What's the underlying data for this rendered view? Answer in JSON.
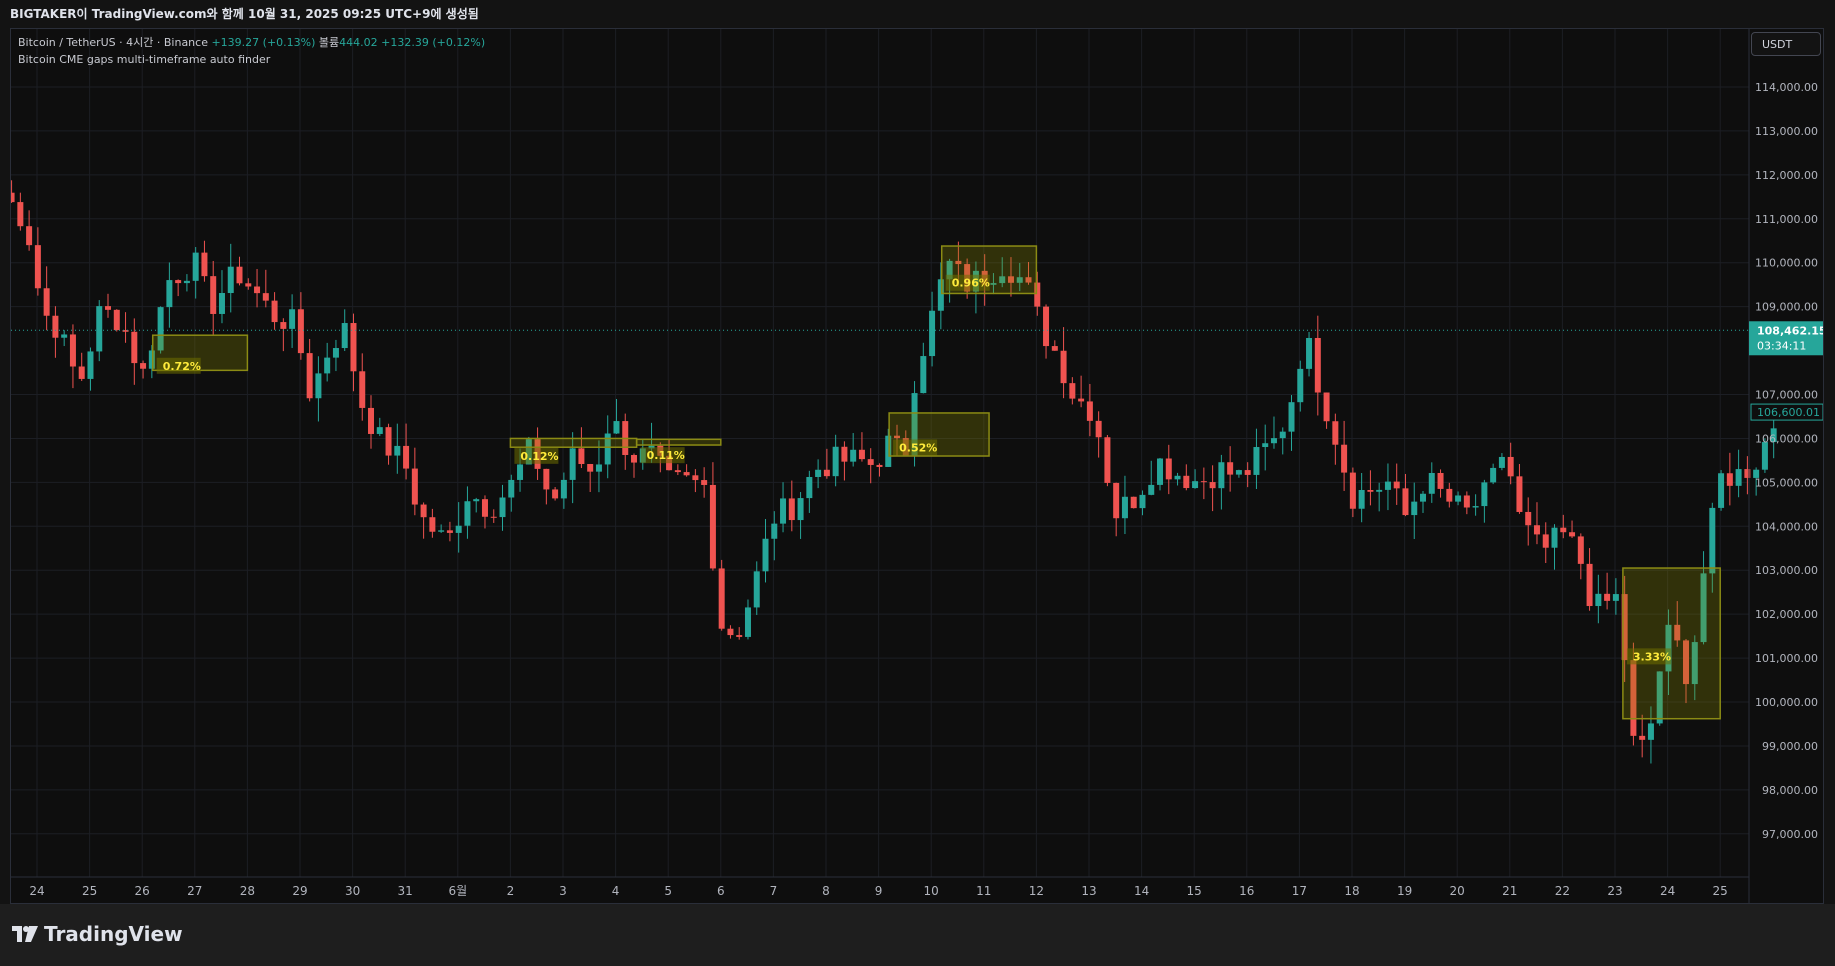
{
  "header": {
    "title": "BIGTAKER이 TradingView.com와 함께 10월 31, 2025 09:25 UTC+9에 생성됨"
  },
  "legend": {
    "symbol": "Bitcoin / TetherUS · 4시간 · Binance",
    "change": "+139.27 (+0.13%)",
    "volume_label": "볼륨",
    "volume_value": "444.02",
    "volume_change": "+132.39 (+0.12%)",
    "indicator": "Bitcoin CME gaps multi-timeframe auto finder"
  },
  "currency_button": "USDT",
  "brand": "TradingView",
  "colors": {
    "up": "#26a69a",
    "down": "#ef5350",
    "gap_fill": "rgba(139,139,0,0.28)",
    "gap_border": "#8b8b14",
    "gap_text": "#ffeb3b",
    "last_price_bg": "#26a69a"
  },
  "chart_data": {
    "type": "candlestick",
    "x_tick_labels": [
      "24",
      "25",
      "26",
      "27",
      "28",
      "29",
      "30",
      "31",
      "6월",
      "2",
      "3",
      "4",
      "5",
      "6",
      "7",
      "8",
      "9",
      "10",
      "11",
      "12",
      "13",
      "14",
      "15",
      "16",
      "17",
      "18",
      "19",
      "20",
      "21",
      "22",
      "23",
      "24",
      "25"
    ],
    "y_tick_labels": [
      "114,000.00",
      "113,000.00",
      "112,000.00",
      "111,000.00",
      "110,000.00",
      "109,000.00",
      "107,000.00",
      "106,000.00",
      "105,000.00",
      "104,000.00",
      "103,000.00",
      "102,000.00",
      "101,000.00",
      "100,000.00",
      "99,000.00",
      "98,000.00",
      "97,000.00"
    ],
    "ylim": [
      96400,
      114800
    ],
    "xlim_days": [
      -0.65,
      32.4
    ],
    "last_price": {
      "value": 108462.15,
      "label": "108,462.15",
      "countdown": "03:34:11"
    },
    "previous_marker": {
      "value": 106600.01,
      "label": "106,600.01"
    },
    "cme_gaps": [
      {
        "x0": 2.2,
        "x1": 4.0,
        "top": 108350,
        "bottom": 107550,
        "label": "0.72%"
      },
      {
        "x0": 9.0,
        "x1": 11.4,
        "top": 106000,
        "bottom": 105800,
        "label": "0.12%"
      },
      {
        "x0": 11.4,
        "x1": 13.0,
        "top": 105980,
        "bottom": 105850,
        "label": "0.11%"
      },
      {
        "x0": 16.2,
        "x1": 18.1,
        "top": 106580,
        "bottom": 105600,
        "label": "0.52%"
      },
      {
        "x0": 17.2,
        "x1": 19.0,
        "top": 110380,
        "bottom": 109300,
        "label": "0.96%"
      },
      {
        "x0": 30.15,
        "x1": 32.0,
        "top": 103050,
        "bottom": 99620,
        "label": "3.33%"
      }
    ],
    "key_points": [
      {
        "d": -0.65,
        "p": 111600
      },
      {
        "d": -0.2,
        "p": 110900
      },
      {
        "d": 0.1,
        "p": 108900
      },
      {
        "d": 0.4,
        "p": 108500
      },
      {
        "d": 0.8,
        "p": 107200
      },
      {
        "d": 1.2,
        "p": 108900
      },
      {
        "d": 1.6,
        "p": 108700
      },
      {
        "d": 2.0,
        "p": 107400
      },
      {
        "d": 2.2,
        "p": 108300
      },
      {
        "d": 2.5,
        "p": 109600
      },
      {
        "d": 3.0,
        "p": 110000
      },
      {
        "d": 3.3,
        "p": 109000
      },
      {
        "d": 3.8,
        "p": 109800
      },
      {
        "d": 4.1,
        "p": 109400
      },
      {
        "d": 4.5,
        "p": 108800
      },
      {
        "d": 4.9,
        "p": 108600
      },
      {
        "d": 5.2,
        "p": 107000
      },
      {
        "d": 5.6,
        "p": 108200
      },
      {
        "d": 5.9,
        "p": 108500
      },
      {
        "d": 6.1,
        "p": 107000
      },
      {
        "d": 6.5,
        "p": 106000
      },
      {
        "d": 7.0,
        "p": 105400
      },
      {
        "d": 7.3,
        "p": 104200
      },
      {
        "d": 7.8,
        "p": 103600
      },
      {
        "d": 8.2,
        "p": 104800
      },
      {
        "d": 8.6,
        "p": 104400
      },
      {
        "d": 9.0,
        "p": 104900
      },
      {
        "d": 9.4,
        "p": 105800
      },
      {
        "d": 9.8,
        "p": 104500
      },
      {
        "d": 10.2,
        "p": 105600
      },
      {
        "d": 10.6,
        "p": 105200
      },
      {
        "d": 10.9,
        "p": 106500
      },
      {
        "d": 11.3,
        "p": 105600
      },
      {
        "d": 11.7,
        "p": 105600
      },
      {
        "d": 12.0,
        "p": 105000
      },
      {
        "d": 12.4,
        "p": 105000
      },
      {
        "d": 12.7,
        "p": 104900
      },
      {
        "d": 13.0,
        "p": 101800
      },
      {
        "d": 13.3,
        "p": 101500
      },
      {
        "d": 13.6,
        "p": 102500
      },
      {
        "d": 14.0,
        "p": 104200
      },
      {
        "d": 14.4,
        "p": 104500
      },
      {
        "d": 14.8,
        "p": 105300
      },
      {
        "d": 15.2,
        "p": 105500
      },
      {
        "d": 15.6,
        "p": 105500
      },
      {
        "d": 15.9,
        "p": 105400
      },
      {
        "d": 16.2,
        "p": 105900
      },
      {
        "d": 16.5,
        "p": 105600
      },
      {
        "d": 16.7,
        "p": 107500
      },
      {
        "d": 17.0,
        "p": 108700
      },
      {
        "d": 17.3,
        "p": 110000
      },
      {
        "d": 17.7,
        "p": 109500
      },
      {
        "d": 18.0,
        "p": 109700
      },
      {
        "d": 18.4,
        "p": 110000
      },
      {
        "d": 18.8,
        "p": 109500
      },
      {
        "d": 19.1,
        "p": 108500
      },
      {
        "d": 19.4,
        "p": 107900
      },
      {
        "d": 19.7,
        "p": 107000
      },
      {
        "d": 20.1,
        "p": 106600
      },
      {
        "d": 20.5,
        "p": 104300
      },
      {
        "d": 20.9,
        "p": 104700
      },
      {
        "d": 21.3,
        "p": 105500
      },
      {
        "d": 21.7,
        "p": 105200
      },
      {
        "d": 22.1,
        "p": 105000
      },
      {
        "d": 22.5,
        "p": 105300
      },
      {
        "d": 22.9,
        "p": 105100
      },
      {
        "d": 23.3,
        "p": 105700
      },
      {
        "d": 23.6,
        "p": 106000
      },
      {
        "d": 23.9,
        "p": 107100
      },
      {
        "d": 24.1,
        "p": 108400
      },
      {
        "d": 24.4,
        "p": 107100
      },
      {
        "d": 24.7,
        "p": 106000
      },
      {
        "d": 25.0,
        "p": 104700
      },
      {
        "d": 25.3,
        "p": 104800
      },
      {
        "d": 25.7,
        "p": 105000
      },
      {
        "d": 26.0,
        "p": 104200
      },
      {
        "d": 26.4,
        "p": 105100
      },
      {
        "d": 26.8,
        "p": 104600
      },
      {
        "d": 27.2,
        "p": 104300
      },
      {
        "d": 27.6,
        "p": 104800
      },
      {
        "d": 27.9,
        "p": 105800
      },
      {
        "d": 28.2,
        "p": 104100
      },
      {
        "d": 28.6,
        "p": 103400
      },
      {
        "d": 29.0,
        "p": 103800
      },
      {
        "d": 29.3,
        "p": 103400
      },
      {
        "d": 29.6,
        "p": 102100
      },
      {
        "d": 29.9,
        "p": 102300
      },
      {
        "d": 30.1,
        "p": 102400
      },
      {
        "d": 30.3,
        "p": 99100
      },
      {
        "d": 30.6,
        "p": 98900
      },
      {
        "d": 30.9,
        "p": 101100
      },
      {
        "d": 31.1,
        "p": 101800
      },
      {
        "d": 31.3,
        "p": 100500
      },
      {
        "d": 31.5,
        "p": 101300
      },
      {
        "d": 31.7,
        "p": 103100
      },
      {
        "d": 32.0,
        "p": 105100
      },
      {
        "d": 32.4,
        "p": 105200
      },
      {
        "d": 32.7,
        "p": 105500
      },
      {
        "d": 33.0,
        "p": 106300
      },
      {
        "d": 33.1,
        "p": 106600
      }
    ]
  }
}
